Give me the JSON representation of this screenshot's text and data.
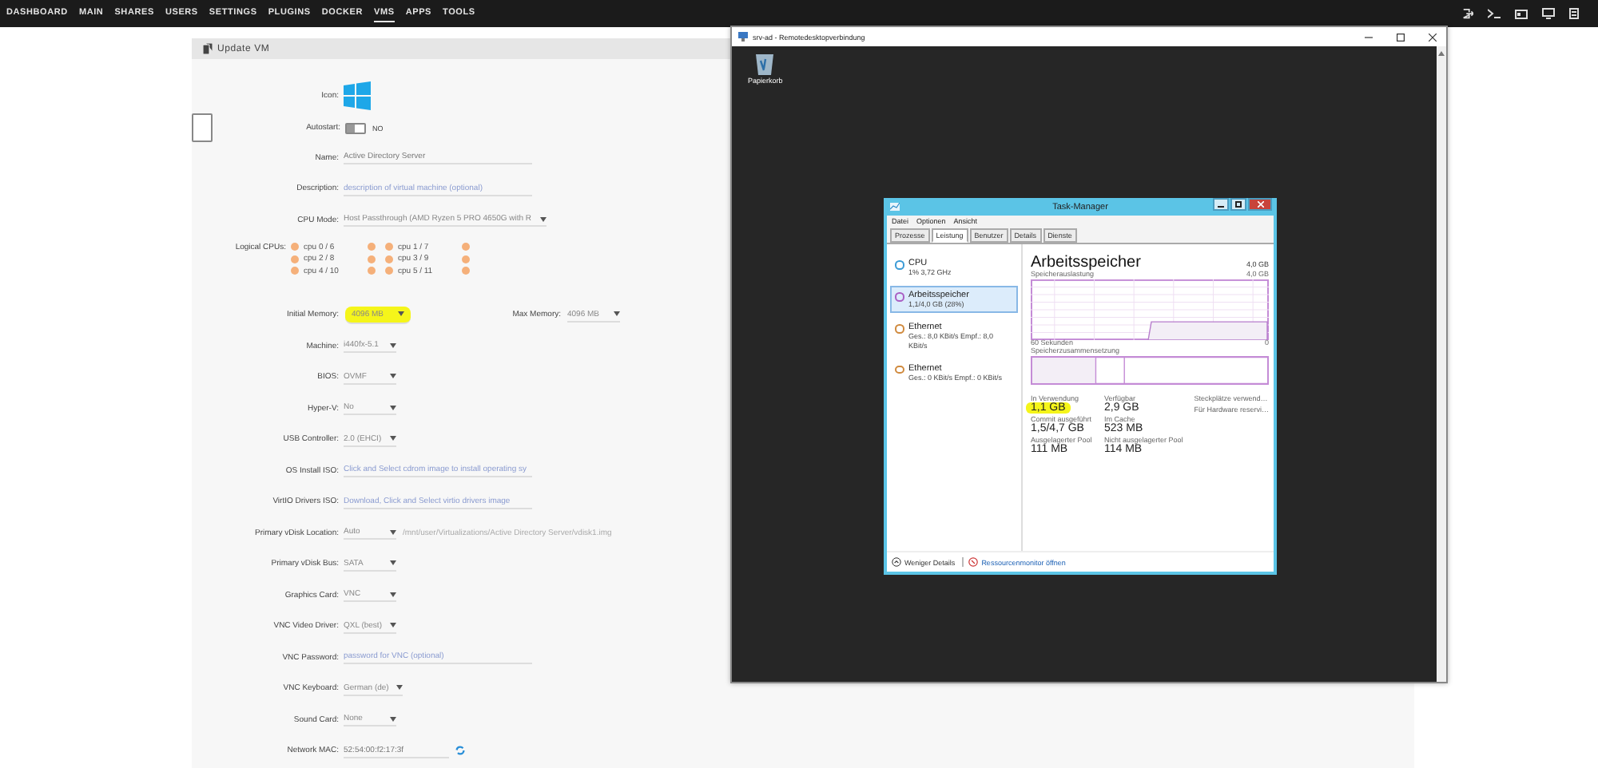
{
  "nav": {
    "items": [
      {
        "label": "DASHBOARD",
        "selected": false
      },
      {
        "label": "MAIN",
        "selected": false
      },
      {
        "label": "SHARES",
        "selected": false
      },
      {
        "label": "USERS",
        "selected": false
      },
      {
        "label": "SETTINGS",
        "selected": false
      },
      {
        "label": "PLUGINS",
        "selected": false
      },
      {
        "label": "DOCKER",
        "selected": false
      },
      {
        "label": "VMS",
        "selected": true
      },
      {
        "label": "APPS",
        "selected": false
      },
      {
        "label": "TOOLS",
        "selected": false
      }
    ]
  },
  "panel": {
    "title": "Update VM"
  },
  "form": [
    {
      "kind": "icon",
      "label": "Icon:"
    },
    {
      "kind": "toggle",
      "label": "Autostart:",
      "on": false,
      "value": "NO"
    },
    {
      "kind": "text",
      "label": "Name:",
      "value": "Active Directory Server"
    },
    {
      "kind": "text",
      "label": "Description:",
      "placeholder": "description of virtual machine (optional)"
    },
    {
      "kind": "select",
      "label": "CPU Mode:",
      "value": "Host Passthrough (AMD Ryzen 5 PRO 4650G with R"
    },
    {
      "kind": "cpus",
      "label": "Logical CPUs:",
      "cpus": [
        {
          "label": "cpu 0 / 6",
          "checks": [
            false,
            false
          ]
        },
        {
          "label": "cpu 1 / 7",
          "checks": [
            false,
            false
          ]
        },
        {
          "label": "cpu 2 / 8",
          "checks": [
            false,
            false
          ]
        },
        {
          "label": "cpu 3 / 9",
          "checks": [
            false,
            false
          ]
        },
        {
          "label": "cpu 4 / 10",
          "checks": [
            false,
            false
          ]
        },
        {
          "label": "cpu 5 / 11",
          "checks": [
            false,
            false
          ]
        }
      ]
    },
    {
      "kind": "memory",
      "label": "Initial Memory:",
      "value": "4096 MB",
      "highlighted": true,
      "max_label": "Max Memory:",
      "max_value": "4096 MB"
    },
    {
      "kind": "select",
      "label": "Machine:",
      "value": "i440fx-5.1"
    },
    {
      "kind": "select",
      "label": "BIOS:",
      "value": "OVMF"
    },
    {
      "kind": "select",
      "label": "Hyper-V:",
      "value": "No"
    },
    {
      "kind": "select",
      "label": "USB Controller:",
      "value": "2.0 (EHCI)"
    },
    {
      "kind": "text",
      "label": "OS Install ISO:",
      "placeholder": "Click and Select cdrom image to install operating sy"
    },
    {
      "kind": "text",
      "label": "VirtIO Drivers ISO:",
      "placeholder": "Download, Click and Select virtio drivers image"
    },
    {
      "kind": "vdisk",
      "label": "Primary vDisk Location:",
      "value": "Auto",
      "path": "/mnt/user/Virtualizations/Active Directory Server/vdisk1.img"
    },
    {
      "kind": "select",
      "label": "Primary vDisk Bus:",
      "value": "SATA"
    },
    {
      "kind": "select",
      "label": "Graphics Card:",
      "value": "VNC"
    },
    {
      "kind": "select",
      "label": "VNC Video Driver:",
      "value": "QXL (best)"
    },
    {
      "kind": "text",
      "label": "VNC Password:",
      "placeholder": "password for VNC (optional)"
    },
    {
      "kind": "select",
      "label": "VNC Keyboard:",
      "value": "German (de)"
    },
    {
      "kind": "select",
      "label": "Sound Card:",
      "value": "None"
    },
    {
      "kind": "mac",
      "label": "Network MAC:",
      "value": "52:54:00:f2:17:3f"
    }
  ],
  "remote_window": {
    "title": "srv-ad - Remotedesktopverbindung",
    "desktop_icon": "Papierkorb",
    "task_manager": {
      "title": "Task-Manager",
      "menu": [
        "Datei",
        "Optionen",
        "Ansicht"
      ],
      "tabs": [
        {
          "label": "Prozesse",
          "selected": false
        },
        {
          "label": "Leistung",
          "selected": true
        },
        {
          "label": "Benutzer",
          "selected": false
        },
        {
          "label": "Details",
          "selected": false
        },
        {
          "label": "Dienste",
          "selected": false
        }
      ],
      "resources": [
        {
          "name": "CPU",
          "detail": "1% 3,72 GHz",
          "color": "#3c9bd6",
          "selected": false
        },
        {
          "name": "Arbeitsspeicher",
          "detail": "1,1/4,0 GB (28%)",
          "color": "#a95fc4",
          "selected": true
        },
        {
          "name": "Ethernet",
          "detail": "Ges.: 8,0 KBit/s Empf.: 8,0 KBit/s",
          "color": "#d08a3e",
          "selected": false
        },
        {
          "name": "Ethernet",
          "detail": "Ges.: 0 KBit/s Empf.: 0 KBit/s",
          "color": "#d08a3e",
          "selected": false
        }
      ],
      "heading": "Arbeitsspeicher",
      "total": "4,0 GB",
      "graph_label": "Speicherauslastung",
      "graph_max": "4,0 GB",
      "graph_time": "60 Sekunden",
      "graph_min": "0",
      "composition_label": "Speicherzusammensetzung",
      "stats": [
        {
          "label": "In Verwendung",
          "value": "1,1 GB",
          "highlighted": true
        },
        {
          "label": "Verfügbar",
          "value": "2,9 GB",
          "highlighted": false
        },
        {
          "label": "Commit ausgeführt",
          "value": "1,5/4,7 GB",
          "highlighted": false
        },
        {
          "label": "Im Cache",
          "value": "523 MB",
          "highlighted": false
        },
        {
          "label": "Ausgelagerter Pool",
          "value": "111 MB",
          "highlighted": false
        },
        {
          "label": "Nicht ausgelagerter Pool",
          "value": "114 MB",
          "highlighted": false
        }
      ],
      "notes": [
        "Steckplätze verwend…",
        "Für Hardware reservi…"
      ],
      "fewer_details": "Weniger Details",
      "monitor_link": "Ressourcenmonitor öffnen"
    }
  }
}
